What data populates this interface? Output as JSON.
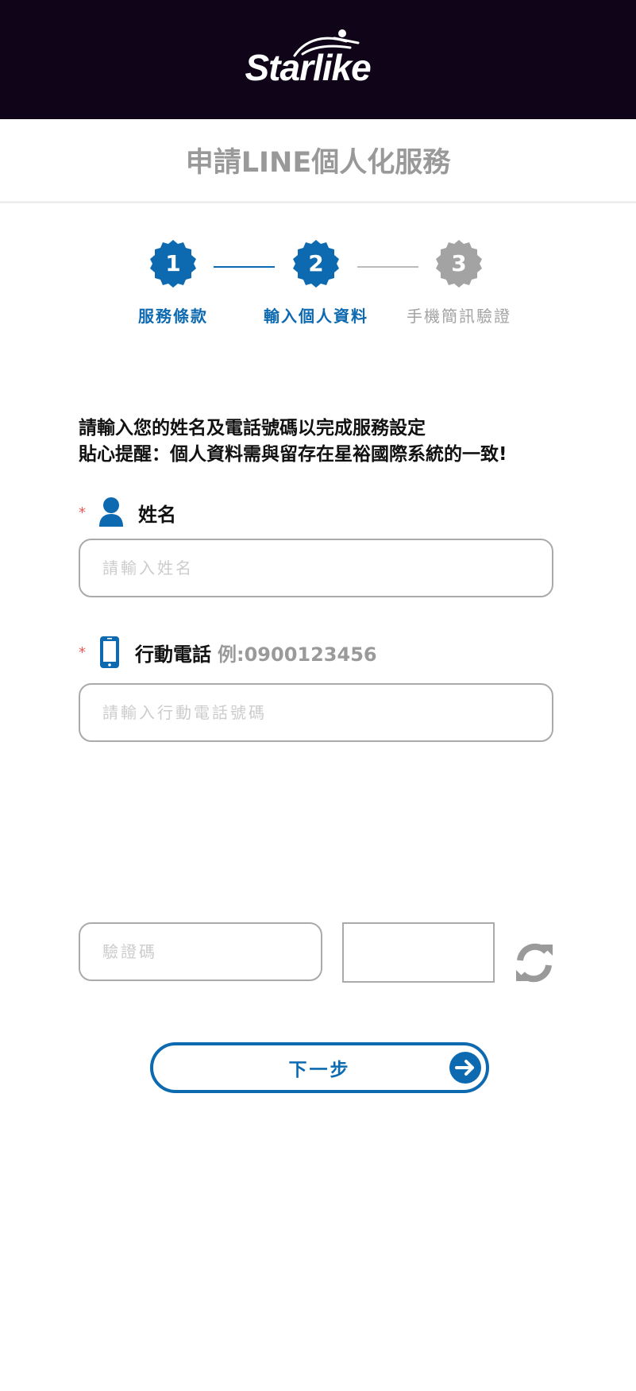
{
  "header": {
    "logo_text": "Starlike"
  },
  "page_title": "申請LINE個人化服務",
  "steps": [
    {
      "number": "1",
      "label": "服務條款",
      "state": "done"
    },
    {
      "number": "2",
      "label": "輸入個人資料",
      "state": "current"
    },
    {
      "number": "3",
      "label": "手機簡訊驗證",
      "state": "pending"
    }
  ],
  "intro": {
    "line1": "請輸入您的姓名及電話號碼以完成服務設定",
    "line2": "貼心提醒：個人資料需與留存在星裕國際系統的一致!"
  },
  "name_field": {
    "required_mark": "*",
    "label": "姓名",
    "icon": "user-icon",
    "value": "",
    "placeholder": "請輸入姓名"
  },
  "phone_field": {
    "required_mark": "*",
    "label": "行動電話",
    "hint": "例:0900123456",
    "icon": "mobile-phone-icon",
    "value": "",
    "placeholder": "請輸入行動電話號碼"
  },
  "captcha": {
    "placeholder": "驗證碼",
    "value": "",
    "refresh_icon": "refresh-icon"
  },
  "next_button": {
    "label": "下一步",
    "icon": "arrow-right-circle-icon"
  },
  "colors": {
    "header_bg": "#0f0418",
    "accent_blue": "#0d6ab0",
    "inactive_gray": "#a3a3a3",
    "required_red": "#e85a5a",
    "title_gray": "#999999"
  }
}
